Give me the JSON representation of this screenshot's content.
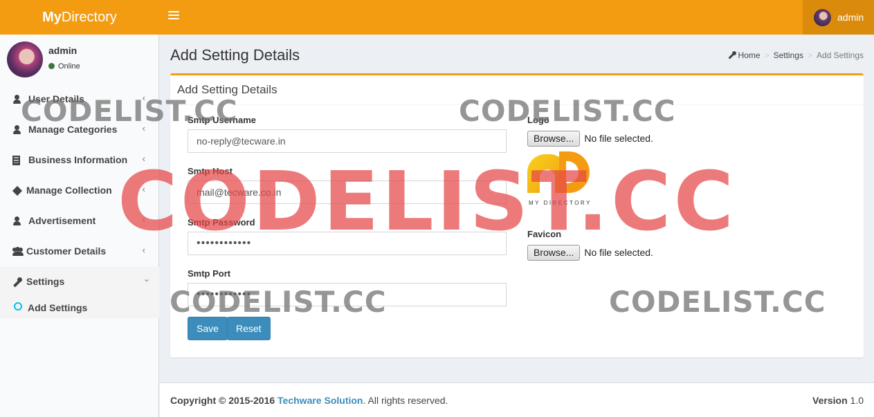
{
  "app": {
    "brand_bold": "My",
    "brand_rest": "Directory",
    "user_name": "admin"
  },
  "sidebar": {
    "user": {
      "name": "admin",
      "status": "Online"
    },
    "items": [
      {
        "label": "User Details",
        "icon": "user-icon"
      },
      {
        "label": "Manage Categories",
        "icon": "user-icon"
      },
      {
        "label": "Business Information",
        "icon": "building-icon"
      },
      {
        "label": "Manage Collection",
        "icon": "cube-icon"
      },
      {
        "label": "Advertisement",
        "icon": "user-icon"
      },
      {
        "label": "Customer Details",
        "icon": "users-icon"
      },
      {
        "label": "Settings",
        "icon": "wrench-icon"
      }
    ],
    "sub_items": [
      {
        "label": "Add Settings"
      }
    ]
  },
  "header": {
    "title": "Add Setting Details",
    "breadcrumb": [
      "Home",
      "Settings",
      "Add Settings"
    ]
  },
  "form": {
    "box_title": "Add Setting Details",
    "smtp_username_label": "Smtp Username",
    "smtp_username_value": "no-reply@tecware.in",
    "smtp_host_label": "Smtp Host",
    "smtp_host_value": "mail@tecware.co.in",
    "smtp_password_label": "Smtp Password",
    "smtp_password_value": "••••••••••••",
    "smtp_port_label": "Smtp Port",
    "smtp_port_value": "••••••••••••",
    "save_label": "Save",
    "reset_label": "Reset",
    "logo_label": "Logo",
    "favicon_label": "Favicon",
    "browse_label": "Browse...",
    "no_file_text": "No file selected.",
    "logo_preview_text": "MY DIRECTORY"
  },
  "footer": {
    "copyright_prefix": "Copyright © 2015-2016",
    "company": "Techware Solution",
    "copyright_suffix": ". All rights reserved.",
    "version_label": "Version",
    "version_value": "1.0"
  },
  "watermark": {
    "text": "CODELIST.CC"
  },
  "colors": {
    "accent": "#f39c12",
    "primary": "#3c8dbc",
    "online": "#3c763d",
    "sub_ring": "#00c0ef"
  }
}
